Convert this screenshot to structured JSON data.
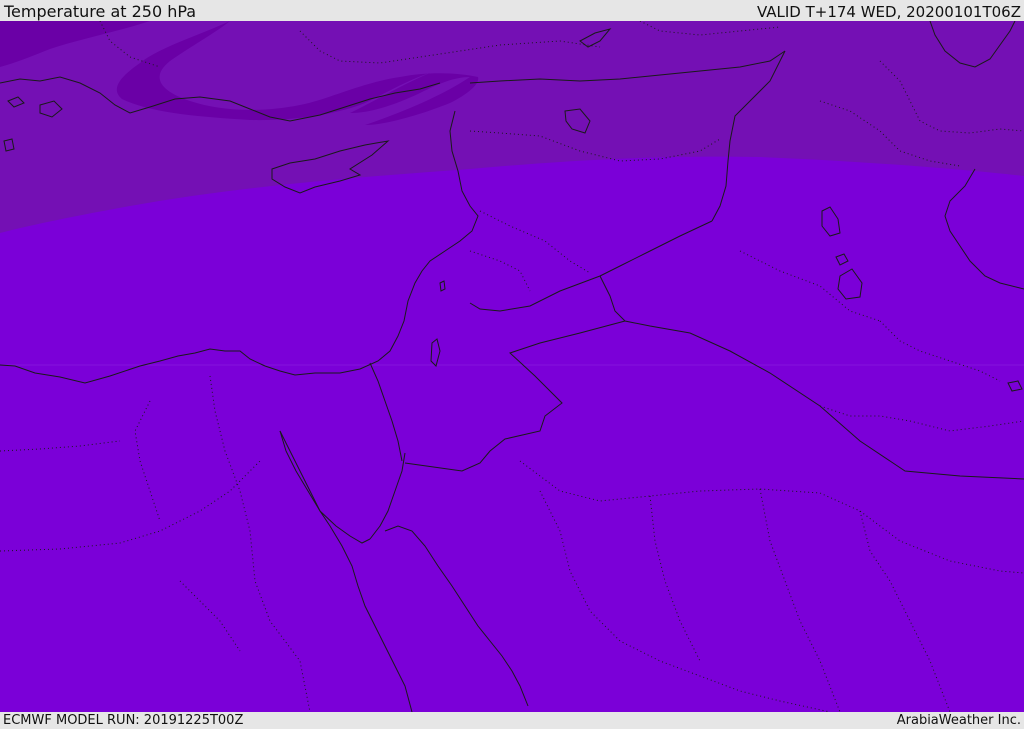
{
  "header": {
    "title": "Temperature at 250 hPa",
    "valid_time": "VALID T+174 WED, 20200101T06Z"
  },
  "footer": {
    "model_run": "ECMWF MODEL RUN: 20191225T00Z",
    "brand": "ArabiaWeather Inc."
  },
  "map": {
    "colors": {
      "cold_core": "#6a00a6",
      "cold_band": "#7410b4",
      "base_field": "#7b00d8",
      "land_borders": "#1a1a1a"
    }
  }
}
